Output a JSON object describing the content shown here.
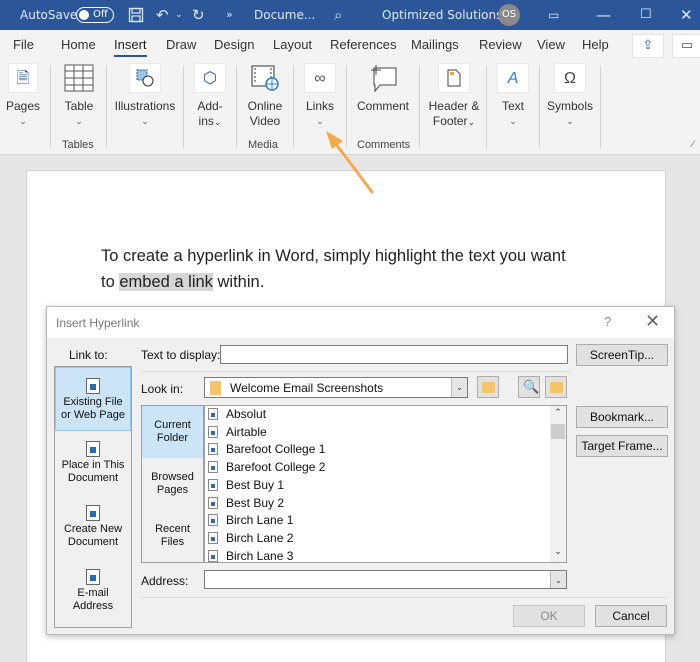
{
  "titlebar": {
    "autosave_label": "AutoSave",
    "autosave_state": "Off",
    "more_label": "»",
    "doc_name": "Docume...",
    "account_name": "Optimized Solutions",
    "avatar_initials": "OS",
    "icons": [
      "save-icon",
      "undo-icon",
      "redo-icon",
      "search-icon",
      "ribbon-display-icon",
      "minimize-icon",
      "maximize-icon",
      "close-icon"
    ]
  },
  "tabs": [
    {
      "label": "File"
    },
    {
      "label": "Home"
    },
    {
      "label": "Insert",
      "active": true
    },
    {
      "label": "Draw"
    },
    {
      "label": "Design"
    },
    {
      "label": "Layout"
    },
    {
      "label": "References"
    },
    {
      "label": "Mailings"
    },
    {
      "label": "Review"
    },
    {
      "label": "View"
    },
    {
      "label": "Help"
    }
  ],
  "ribbon": {
    "buttons": {
      "pages": "Pages",
      "table": "Table",
      "illustrations": "Illustrations",
      "addins1": "Add-",
      "addins2": "ins",
      "online_video1": "Online",
      "online_video2": "Video",
      "links": "Links",
      "comment": "Comment",
      "header_footer1": "Header &",
      "header_footer2": "Footer",
      "text": "Text",
      "symbols": "Symbols"
    },
    "groups": {
      "tables": "Tables",
      "media": "Media",
      "comments": "Comments"
    },
    "chevron": "⌄"
  },
  "document": {
    "text_before": "To create a hyperlink in Word, simply highlight the text you want to ",
    "highlighted": "embed a link",
    "text_after": " within."
  },
  "annotation": {
    "arrow_color": "#f5a94b"
  },
  "dialog": {
    "title": "Insert Hyperlink",
    "help": "?",
    "close": "✕",
    "link_to_label": "Link to:",
    "link_to": {
      "existing_1": "Existing File",
      "existing_2": "or Web Page",
      "place_1": "Place in This",
      "place_2": "Document",
      "create_1": "Create New",
      "create_2": "Document",
      "email_1": "E-mail",
      "email_2": "Address"
    },
    "text_to_display_label": "Text to display:",
    "text_to_display_value": "",
    "screentip": "ScreenTip...",
    "look_in_label": "Look in:",
    "look_in_value": "Welcome Email Screenshots",
    "categories": {
      "current_1": "Current",
      "current_2": "Folder",
      "browsed_1": "Browsed",
      "browsed_2": "Pages",
      "recent_1": "Recent",
      "recent_2": "Files"
    },
    "files": [
      "Absolut",
      "Airtable",
      "Barefoot College 1",
      "Barefoot College 2",
      "Best Buy 1",
      "Best Buy 2",
      "Birch Lane 1",
      "Birch Lane 2",
      "Birch Lane 3"
    ],
    "bookmark": "Bookmark...",
    "target_frame": "Target Frame...",
    "address_label": "Address:",
    "address_value": "",
    "ok": "OK",
    "cancel": "Cancel"
  }
}
